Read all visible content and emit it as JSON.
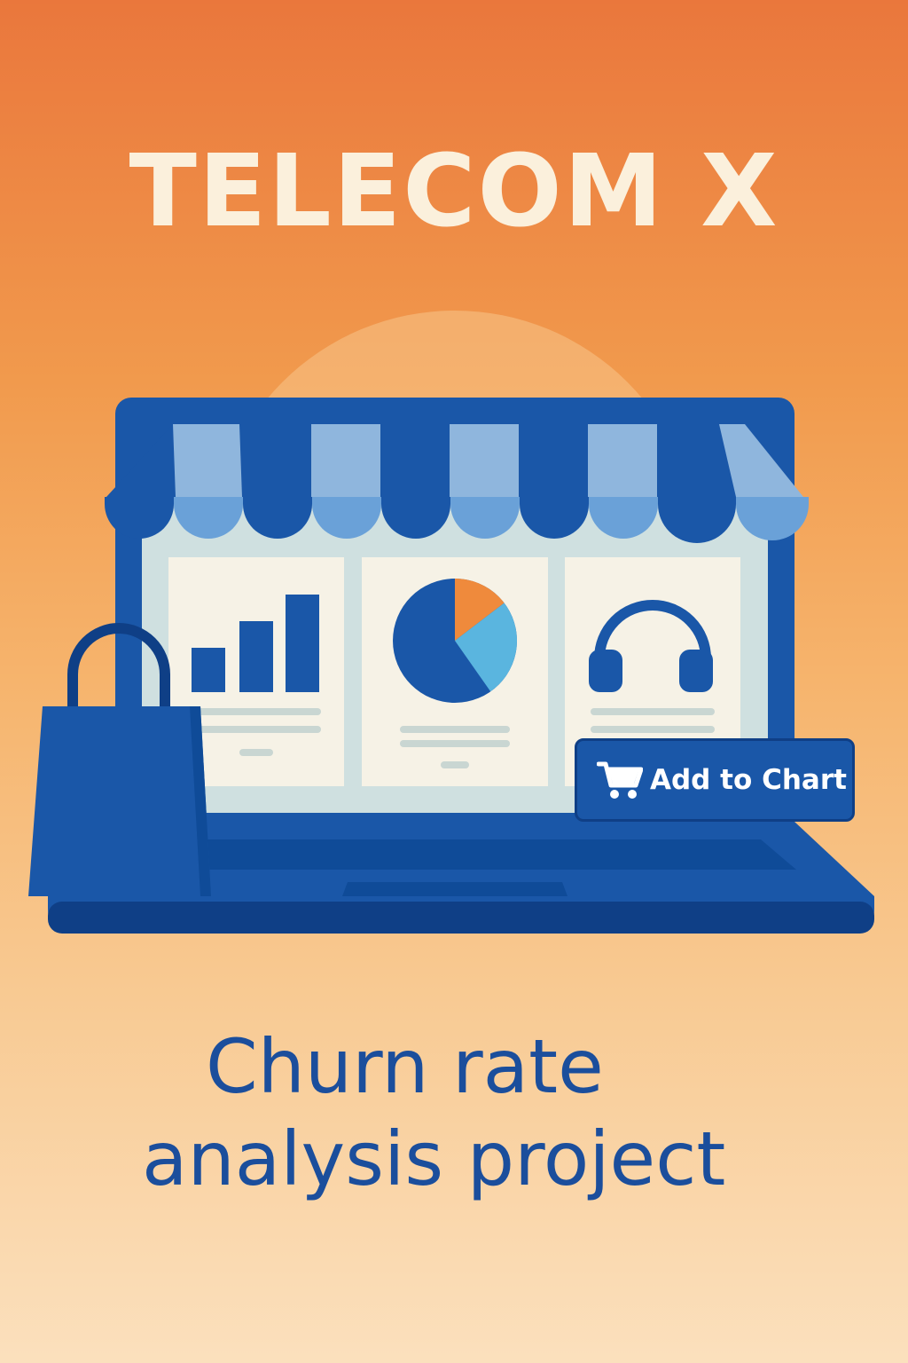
{
  "poster": {
    "title": "TELECOM X",
    "subtitle_line1": "Churn rate",
    "subtitle_line2": "analysis project"
  },
  "screen": {
    "cards": [
      {
        "icon": "bar-chart-icon"
      },
      {
        "icon": "pie-chart-icon"
      },
      {
        "icon": "headphones-icon"
      }
    ]
  },
  "cart_button": {
    "label": "Add to Chart",
    "icon": "shopping-cart-icon"
  },
  "bag": {
    "icon": "shopping-bag-icon"
  },
  "colors": {
    "navy": "#0f3f86",
    "blue": "#1a57a8",
    "light_blue": "#8fb6dd",
    "sky_blue": "#5ab5df",
    "orange": "#ef8a3c",
    "cream": "#fbf0dc",
    "card_bg": "#f6f2e6",
    "screen_bg": "#cfe0e0"
  }
}
